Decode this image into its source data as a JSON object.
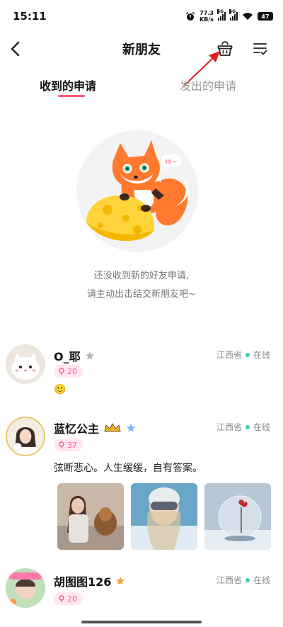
{
  "status_bar": {
    "time": "15:11",
    "net_speed_value": "77.3",
    "net_speed_unit": "KB/s",
    "signal_tag_1": "5G",
    "signal_tag_2": "5G",
    "battery": "47"
  },
  "header": {
    "title": "新朋友",
    "icons": [
      "back-arrow-icon",
      "basket-icon",
      "menu-check-icon"
    ]
  },
  "tabs": [
    {
      "label": "收到的申请",
      "active": true
    },
    {
      "label": "发出的申请",
      "active": false
    }
  ],
  "empty_state": {
    "bubble": "Hi~",
    "line1": "还没收到新的好友申请,",
    "line2": "请主动出击结交新朋友吧~"
  },
  "users": [
    {
      "name": "O_耶",
      "location": "江西省",
      "status": "在线",
      "badge": "20",
      "bio": "🙂"
    },
    {
      "name": "蓝忆公主",
      "location": "江西省",
      "status": "在线",
      "badge": "37",
      "bio": "弦断悲心。人生缓缓，自有答案。"
    },
    {
      "name": "胡图图126",
      "location": "江西省",
      "status": "在线",
      "badge": "20",
      "bio": ""
    }
  ],
  "colors": {
    "accent": "#ff5a6e",
    "online": "#3ccf9a",
    "badge_bg": "#ffe8ef",
    "badge_text": "#ff5a8a"
  }
}
